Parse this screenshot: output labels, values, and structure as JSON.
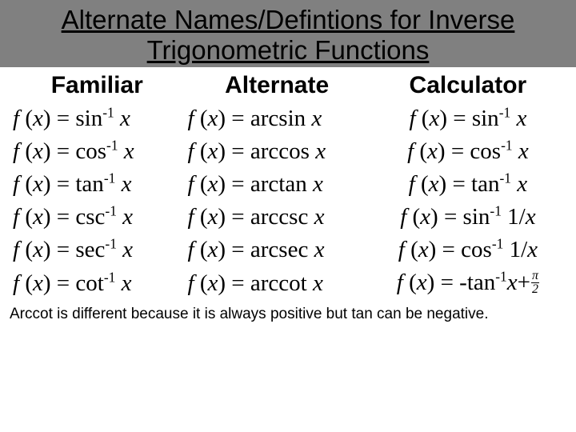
{
  "title": "Alternate Names/Defintions for Inverse Trigonometric Functions",
  "headers": {
    "familiar": "Familiar",
    "alternate": "Alternate",
    "calculator": "Calculator"
  },
  "rows": [
    {
      "fn": "sin",
      "alt": "arcsin",
      "calc_fn": "sin",
      "calc_arg": "x"
    },
    {
      "fn": "cos",
      "alt": "arccos",
      "calc_fn": "cos",
      "calc_arg": "x"
    },
    {
      "fn": "tan",
      "alt": "arctan",
      "calc_fn": "tan",
      "calc_arg": "x"
    },
    {
      "fn": "csc",
      "alt": "arccsc",
      "calc_fn": "sin",
      "calc_arg": "1/x"
    },
    {
      "fn": "sec",
      "alt": "arcsec",
      "calc_fn": "cos",
      "calc_arg": "1/x"
    }
  ],
  "last_row": {
    "fn": "cot",
    "alt": "arccot",
    "calc_prefix": "-tan",
    "calc_arg": "x",
    "frac_num": "π",
    "frac_den": "2"
  },
  "footnote": "Arccot is different because it is always positive but tan can be negative."
}
